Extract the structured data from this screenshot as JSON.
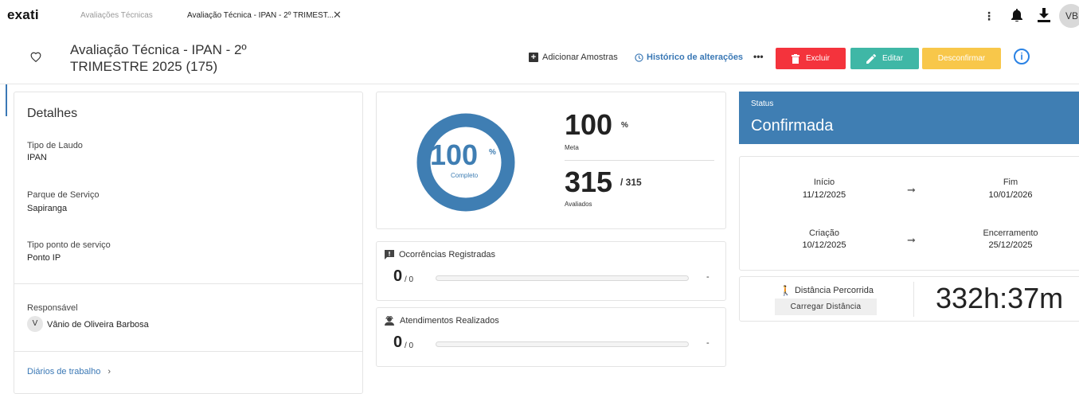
{
  "topbar": {
    "logo": "exati",
    "tabs": [
      {
        "label": "Avaliações Técnicas"
      },
      {
        "label": "Avaliação Técnica - IPAN - 2º TRIMEST..."
      }
    ],
    "avatar_initials": "VB"
  },
  "header": {
    "title": "Avaliação Técnica - IPAN - 2º TRIMESTRE 2025 (175)",
    "actions": {
      "add_samples": "Adicionar Amostras",
      "history": "Histórico de alterações",
      "more": "•••",
      "delete": "Excluir",
      "edit": "Editar",
      "unconfirm": "Desconfirmar"
    },
    "colors": {
      "delete": "#f4333c",
      "edit": "#3fb7a6",
      "unconfirm": "#f8c74a",
      "link": "#3a78b5"
    }
  },
  "details": {
    "heading": "Detalhes",
    "fields": [
      {
        "label": "Tipo de Laudo",
        "value": "IPAN"
      },
      {
        "label": "Parque de Serviço",
        "value": "Sapiranga"
      },
      {
        "label": "Tipo ponto de serviço",
        "value": "Ponto IP"
      }
    ],
    "responsible_label": "Responsável",
    "responsible_initial": "V",
    "responsible_name": "Vânio de Oliveira Barbosa",
    "work_logs_link": "Diários de trabalho"
  },
  "progress": {
    "donut_value": "100",
    "donut_unit": "%",
    "donut_label": "Completo",
    "donut_fraction": 1.0,
    "meta_value": "100",
    "meta_unit": "%",
    "meta_label": "Meta",
    "evaluated_value": "315",
    "evaluated_total": "/ 315",
    "evaluated_label": "Avaliados"
  },
  "occurrences": {
    "title": "Ocorrências Registradas",
    "value": "0",
    "total": "/ 0",
    "status": "-"
  },
  "attendances": {
    "title": "Atendimentos Realizados",
    "value": "0",
    "total": "/ 0",
    "status": "-"
  },
  "status": {
    "label": "Status",
    "value": "Confirmada",
    "color": "#3f7eb3"
  },
  "dates": {
    "start_label": "Início",
    "start_value": "11/12/2025",
    "end_label": "Fim",
    "end_value": "10/01/2026",
    "created_label": "Criação",
    "created_value": "10/12/2025",
    "closing_label": "Encerramento",
    "closing_value": "25/12/2025"
  },
  "distance": {
    "title": "Distância Percorrida",
    "button": "Carregar Distância",
    "time": "332h:37m"
  }
}
